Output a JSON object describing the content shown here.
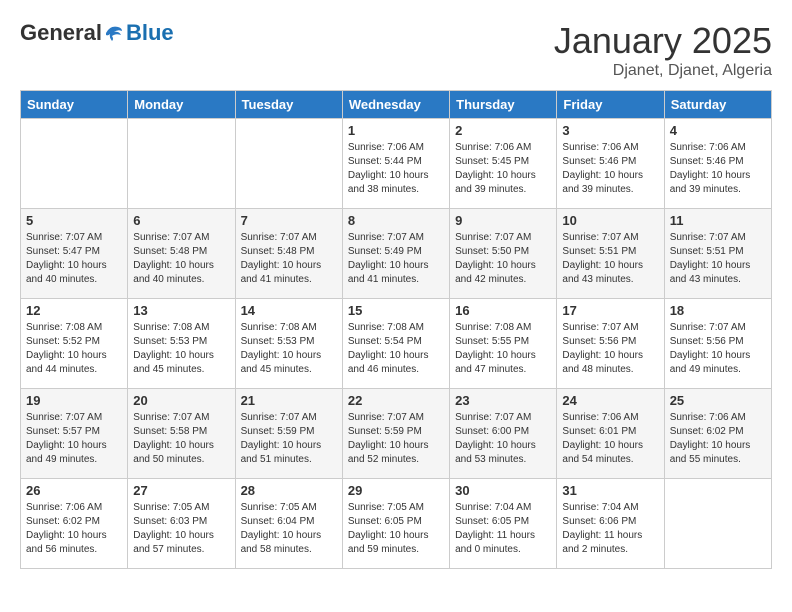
{
  "logo": {
    "general": "General",
    "blue": "Blue"
  },
  "header": {
    "month": "January 2025",
    "location": "Djanet, Djanet, Algeria"
  },
  "weekdays": [
    "Sunday",
    "Monday",
    "Tuesday",
    "Wednesday",
    "Thursday",
    "Friday",
    "Saturday"
  ],
  "weeks": [
    [
      {
        "day": "",
        "info": ""
      },
      {
        "day": "",
        "info": ""
      },
      {
        "day": "",
        "info": ""
      },
      {
        "day": "1",
        "info": "Sunrise: 7:06 AM\nSunset: 5:44 PM\nDaylight: 10 hours\nand 38 minutes."
      },
      {
        "day": "2",
        "info": "Sunrise: 7:06 AM\nSunset: 5:45 PM\nDaylight: 10 hours\nand 39 minutes."
      },
      {
        "day": "3",
        "info": "Sunrise: 7:06 AM\nSunset: 5:46 PM\nDaylight: 10 hours\nand 39 minutes."
      },
      {
        "day": "4",
        "info": "Sunrise: 7:06 AM\nSunset: 5:46 PM\nDaylight: 10 hours\nand 39 minutes."
      }
    ],
    [
      {
        "day": "5",
        "info": "Sunrise: 7:07 AM\nSunset: 5:47 PM\nDaylight: 10 hours\nand 40 minutes."
      },
      {
        "day": "6",
        "info": "Sunrise: 7:07 AM\nSunset: 5:48 PM\nDaylight: 10 hours\nand 40 minutes."
      },
      {
        "day": "7",
        "info": "Sunrise: 7:07 AM\nSunset: 5:48 PM\nDaylight: 10 hours\nand 41 minutes."
      },
      {
        "day": "8",
        "info": "Sunrise: 7:07 AM\nSunset: 5:49 PM\nDaylight: 10 hours\nand 41 minutes."
      },
      {
        "day": "9",
        "info": "Sunrise: 7:07 AM\nSunset: 5:50 PM\nDaylight: 10 hours\nand 42 minutes."
      },
      {
        "day": "10",
        "info": "Sunrise: 7:07 AM\nSunset: 5:51 PM\nDaylight: 10 hours\nand 43 minutes."
      },
      {
        "day": "11",
        "info": "Sunrise: 7:07 AM\nSunset: 5:51 PM\nDaylight: 10 hours\nand 43 minutes."
      }
    ],
    [
      {
        "day": "12",
        "info": "Sunrise: 7:08 AM\nSunset: 5:52 PM\nDaylight: 10 hours\nand 44 minutes."
      },
      {
        "day": "13",
        "info": "Sunrise: 7:08 AM\nSunset: 5:53 PM\nDaylight: 10 hours\nand 45 minutes."
      },
      {
        "day": "14",
        "info": "Sunrise: 7:08 AM\nSunset: 5:53 PM\nDaylight: 10 hours\nand 45 minutes."
      },
      {
        "day": "15",
        "info": "Sunrise: 7:08 AM\nSunset: 5:54 PM\nDaylight: 10 hours\nand 46 minutes."
      },
      {
        "day": "16",
        "info": "Sunrise: 7:08 AM\nSunset: 5:55 PM\nDaylight: 10 hours\nand 47 minutes."
      },
      {
        "day": "17",
        "info": "Sunrise: 7:07 AM\nSunset: 5:56 PM\nDaylight: 10 hours\nand 48 minutes."
      },
      {
        "day": "18",
        "info": "Sunrise: 7:07 AM\nSunset: 5:56 PM\nDaylight: 10 hours\nand 49 minutes."
      }
    ],
    [
      {
        "day": "19",
        "info": "Sunrise: 7:07 AM\nSunset: 5:57 PM\nDaylight: 10 hours\nand 49 minutes."
      },
      {
        "day": "20",
        "info": "Sunrise: 7:07 AM\nSunset: 5:58 PM\nDaylight: 10 hours\nand 50 minutes."
      },
      {
        "day": "21",
        "info": "Sunrise: 7:07 AM\nSunset: 5:59 PM\nDaylight: 10 hours\nand 51 minutes."
      },
      {
        "day": "22",
        "info": "Sunrise: 7:07 AM\nSunset: 5:59 PM\nDaylight: 10 hours\nand 52 minutes."
      },
      {
        "day": "23",
        "info": "Sunrise: 7:07 AM\nSunset: 6:00 PM\nDaylight: 10 hours\nand 53 minutes."
      },
      {
        "day": "24",
        "info": "Sunrise: 7:06 AM\nSunset: 6:01 PM\nDaylight: 10 hours\nand 54 minutes."
      },
      {
        "day": "25",
        "info": "Sunrise: 7:06 AM\nSunset: 6:02 PM\nDaylight: 10 hours\nand 55 minutes."
      }
    ],
    [
      {
        "day": "26",
        "info": "Sunrise: 7:06 AM\nSunset: 6:02 PM\nDaylight: 10 hours\nand 56 minutes."
      },
      {
        "day": "27",
        "info": "Sunrise: 7:05 AM\nSunset: 6:03 PM\nDaylight: 10 hours\nand 57 minutes."
      },
      {
        "day": "28",
        "info": "Sunrise: 7:05 AM\nSunset: 6:04 PM\nDaylight: 10 hours\nand 58 minutes."
      },
      {
        "day": "29",
        "info": "Sunrise: 7:05 AM\nSunset: 6:05 PM\nDaylight: 10 hours\nand 59 minutes."
      },
      {
        "day": "30",
        "info": "Sunrise: 7:04 AM\nSunset: 6:05 PM\nDaylight: 11 hours\nand 0 minutes."
      },
      {
        "day": "31",
        "info": "Sunrise: 7:04 AM\nSunset: 6:06 PM\nDaylight: 11 hours\nand 2 minutes."
      },
      {
        "day": "",
        "info": ""
      }
    ]
  ]
}
